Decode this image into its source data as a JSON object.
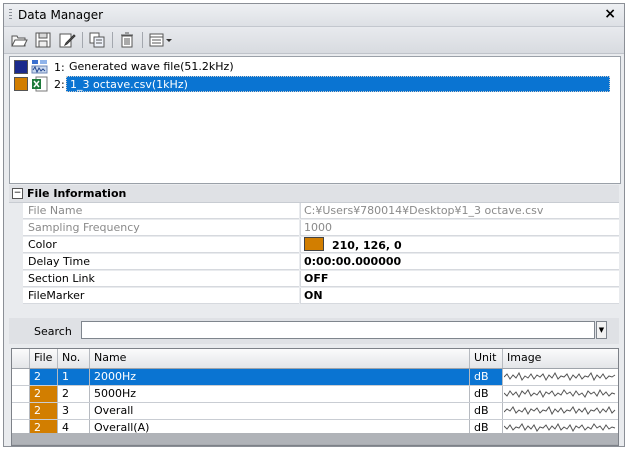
{
  "window": {
    "title": "Data Manager",
    "close_label": "×"
  },
  "toolbar": {
    "buttons": [
      "open-folder-icon",
      "save-icon",
      "edit-icon",
      "export-icon",
      "delete-icon",
      "view-menu-icon"
    ]
  },
  "files": [
    {
      "index": "1:",
      "name": "Generated wave file(51.2kHz)",
      "color": "#1b2a8c",
      "icon": "generated-wave-icon"
    },
    {
      "index": "2:",
      "name": "1_3 octave.csv(1kHz)",
      "color": "#d27e00",
      "icon": "excel-csv-icon",
      "selected": true
    }
  ],
  "file_info": {
    "header": "File Information",
    "properties": [
      {
        "key": "File Name",
        "value": "C:¥Users¥780014¥Desktop¥1_3 octave.csv",
        "disabled": true
      },
      {
        "key": "Sampling Frequency",
        "value": "1000",
        "disabled": true
      },
      {
        "key": "Color",
        "value": "210, 126, 0",
        "swatch": "#d27e00"
      },
      {
        "key": "Delay Time",
        "value": "0:00:00.000000"
      },
      {
        "key": "Section Link",
        "value": "OFF"
      },
      {
        "key": "FileMarker",
        "value": "ON"
      }
    ]
  },
  "search": {
    "label": "Search",
    "value": ""
  },
  "table": {
    "columns": [
      "File",
      "No.",
      "Name",
      "Unit",
      "Image"
    ],
    "rows": [
      {
        "file": "2",
        "no": "1",
        "name": "2000Hz",
        "unit": "dB",
        "selected": true
      },
      {
        "file": "2",
        "no": "2",
        "name": "5000Hz",
        "unit": "dB"
      },
      {
        "file": "2",
        "no": "3",
        "name": "Overall",
        "unit": "dB"
      },
      {
        "file": "2",
        "no": "4",
        "name": "Overall(A)",
        "unit": "dB"
      }
    ]
  }
}
